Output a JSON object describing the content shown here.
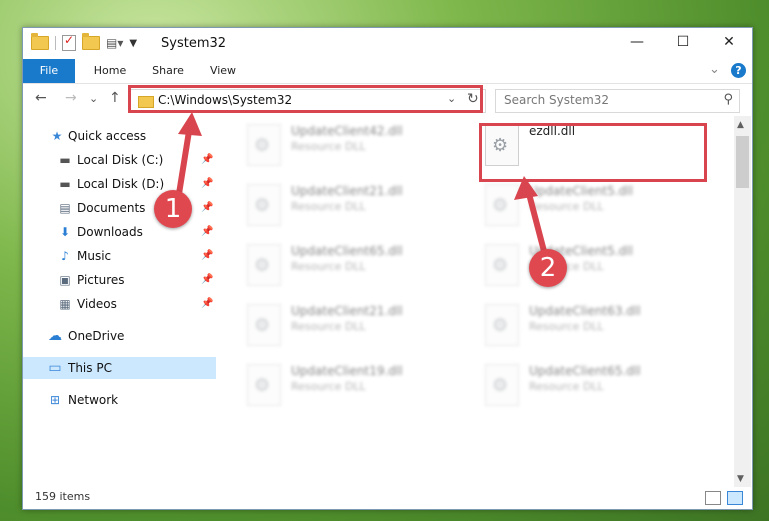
{
  "window": {
    "title": "System32",
    "min_glyph": "—",
    "max_glyph": "☐",
    "close_glyph": "✕"
  },
  "ribbon": {
    "tabs": [
      "File",
      "Home",
      "Share",
      "View"
    ],
    "expand_glyph": "⌄",
    "help_glyph": "?"
  },
  "nav": {
    "back_glyph": "←",
    "forward_glyph": "→",
    "recent_glyph": "⌄",
    "up_glyph": "↑",
    "address": "C:\\Windows\\System32",
    "address_drop_glyph": "⌄",
    "refresh_glyph": "↻",
    "search_placeholder": "Search System32",
    "search_glyph": "⚲"
  },
  "sidebar": {
    "items": [
      {
        "label": "Quick access",
        "icon": "star-icon",
        "glyph": "★"
      },
      {
        "label": "Local Disk (C:)",
        "icon": "drive-icon",
        "glyph": "▬"
      },
      {
        "label": "Local Disk (D:)",
        "icon": "drive-icon",
        "glyph": "▬"
      },
      {
        "label": "Documents",
        "icon": "documents-icon",
        "glyph": "▤"
      },
      {
        "label": "Downloads",
        "icon": "downloads-icon",
        "glyph": "⬇"
      },
      {
        "label": "Music",
        "icon": "music-icon",
        "glyph": "♪"
      },
      {
        "label": "Pictures",
        "icon": "pictures-icon",
        "glyph": "▣"
      },
      {
        "label": "Videos",
        "icon": "videos-icon",
        "glyph": "▦"
      },
      {
        "label": "OneDrive",
        "icon": "cloud-icon",
        "glyph": "☁"
      },
      {
        "label": "This PC",
        "icon": "computer-icon",
        "glyph": "▭"
      },
      {
        "label": "Network",
        "icon": "network-icon",
        "glyph": "⊞"
      }
    ],
    "pin_glyph": "📌"
  },
  "files": {
    "highlighted": {
      "name": "ezdll.dll",
      "type": ""
    },
    "blurred": [
      {
        "name": "UpdateClient42.dll",
        "type": "Resource DLL"
      },
      {
        "name": "UpdateClient21.dll",
        "type": "Resource DLL"
      },
      {
        "name": "UpdateClient5.dll",
        "type": "Resource DLL"
      },
      {
        "name": "UpdateClient65.dll",
        "type": "Resource DLL"
      },
      {
        "name": "UpdateClient5.dll",
        "type": "Resource DLL"
      },
      {
        "name": "UpdateClient21.dll",
        "type": "Resource DLL"
      },
      {
        "name": "UpdateClient63.dll",
        "type": "Resource DLL"
      },
      {
        "name": "UpdateClient19.dll",
        "type": "Resource DLL"
      },
      {
        "name": "UpdateClient65.dll",
        "type": "Resource DLL"
      }
    ]
  },
  "status": {
    "item_count": "159 items"
  },
  "annotations": {
    "step1": "1",
    "step2": "2"
  },
  "colors": {
    "accent": "#1979ca",
    "annotation": "#d9454f",
    "selection": "#cce8ff"
  }
}
